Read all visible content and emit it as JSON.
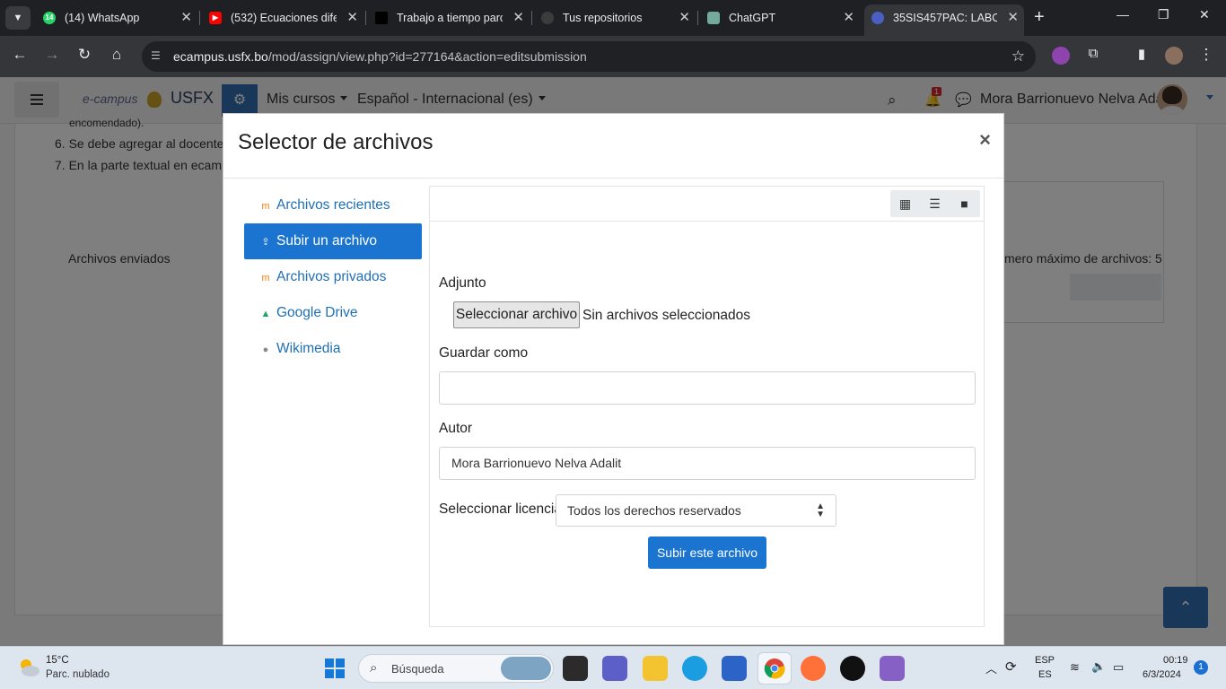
{
  "browser": {
    "tabs": [
      {
        "title": "(14) WhatsApp",
        "badge": "14"
      },
      {
        "title": "(532) Ecuaciones dife"
      },
      {
        "title": "Trabajo a tiempo parc"
      },
      {
        "title": "Tus repositorios"
      },
      {
        "title": "ChatGPT"
      },
      {
        "title": "35SIS457PAC: LABOR"
      }
    ],
    "url_host": "ecampus.usfx.bo",
    "url_path": "/mod/assign/view.php?id=277164&action=editsubmission"
  },
  "moodle": {
    "logo_text": "e-campus",
    "org": "USFX",
    "menu_courses": "Mis cursos",
    "menu_language": "Español - Internacional (es)",
    "notification_count": "1",
    "user_name": "Mora Barrionuevo Nelva Adalit"
  },
  "page": {
    "line_cut": "encomendado).",
    "instruction_6": "6. Se debe agregar al docente c",
    "instruction_7": "7. En la parte textual en ecampu",
    "submitted_files_label": "Archivos enviados",
    "max_files": "mero máximo de archivos: 5"
  },
  "modal": {
    "title": "Selector de archivos",
    "close": "×",
    "repositories": [
      {
        "label": "Archivos recientes",
        "icon": "moodle-icon"
      },
      {
        "label": "Subir un archivo",
        "icon": "upload-icon",
        "active": true
      },
      {
        "label": "Archivos privados",
        "icon": "moodle-icon"
      },
      {
        "label": "Google Drive",
        "icon": "google-drive-icon"
      },
      {
        "label": "Wikimedia",
        "icon": "wikimedia-icon"
      }
    ],
    "attachment_label": "Adjunto",
    "choose_file_button": "Seleccionar archivo",
    "no_file_selected": "Sin archivos seleccionados",
    "save_as_label": "Guardar como",
    "save_as_value": "",
    "author_label": "Autor",
    "author_value": "Mora Barrionuevo Nelva Adalit",
    "license_label": "Seleccionar licencia",
    "license_value": "Todos los derechos reservados",
    "upload_button": "Subir este archivo"
  },
  "taskbar": {
    "weather_temp": "15°C",
    "weather_desc": "Parc. nublado",
    "search_placeholder": "Búsqueda",
    "language": "ESP",
    "region": "ES",
    "time": "00:19",
    "date": "6/3/2024",
    "notifications": "1"
  },
  "colors": {
    "moodle_blue": "#1a74d0",
    "link_blue": "#1f6fb5",
    "chrome_dark": "#35363a"
  }
}
